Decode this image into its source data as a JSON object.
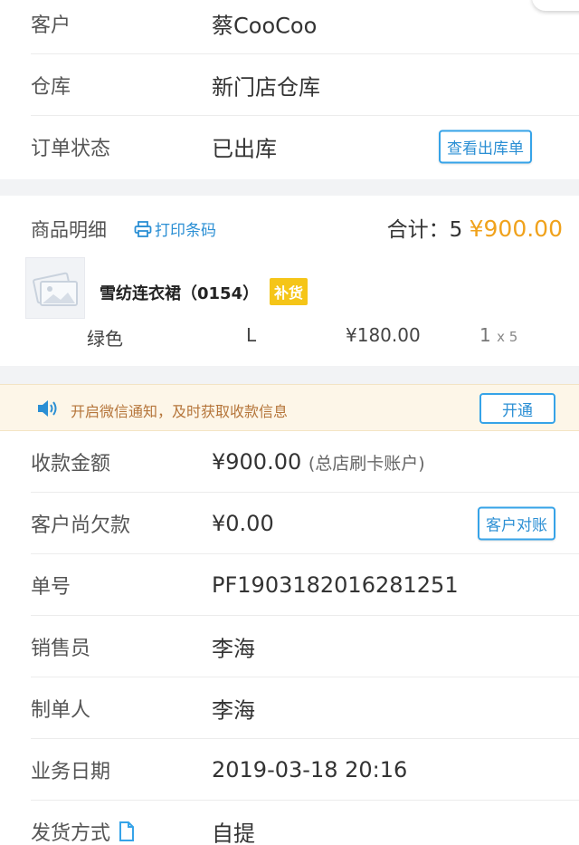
{
  "order": {
    "customer_label": "客户",
    "customer_value": "蔡CooCoo",
    "warehouse_label": "仓库",
    "warehouse_value": "新门店仓库",
    "status_label": "订单状态",
    "status_value": "已出库",
    "view_delivery_button": "查看出库单"
  },
  "goods": {
    "title": "商品明细",
    "print_barcode": "打印条码",
    "total_prefix": "合计：5",
    "total_amount": "¥900.00",
    "product_name": "雪纺连衣裙（0154）",
    "restock_tag": "补货",
    "sku_color": "绿色",
    "sku_size": "L",
    "sku_price": "¥180.00",
    "sku_qty": "1",
    "sku_multiplier": "x 5"
  },
  "notice": {
    "text": "开启微信通知，及时获取收款信息",
    "button": "开通"
  },
  "details": {
    "amount_label": "收款金额",
    "amount_value": "¥900.00",
    "amount_account": "(总店刷卡账户)",
    "debt_label": "客户尚欠款",
    "debt_value": "¥0.00",
    "reconcile_button": "客户对账",
    "number_label": "单号",
    "number_value": "PF1903182016281251",
    "salesperson_label": "销售员",
    "salesperson_value": "李海",
    "creator_label": "制单人",
    "creator_value": "李海",
    "date_label": "业务日期",
    "date_value": "2019-03-18 20:16",
    "shipping_label": "发货方式",
    "shipping_value": "自提"
  },
  "colors": {
    "accent_blue": "#36a3e8",
    "price_orange": "#f0a21c",
    "restock_yellow": "#f5c518",
    "notice_bg": "#fdf6e8"
  },
  "icons": [
    "print-icon",
    "image-placeholder-icon",
    "speaker-icon",
    "document-icon"
  ]
}
